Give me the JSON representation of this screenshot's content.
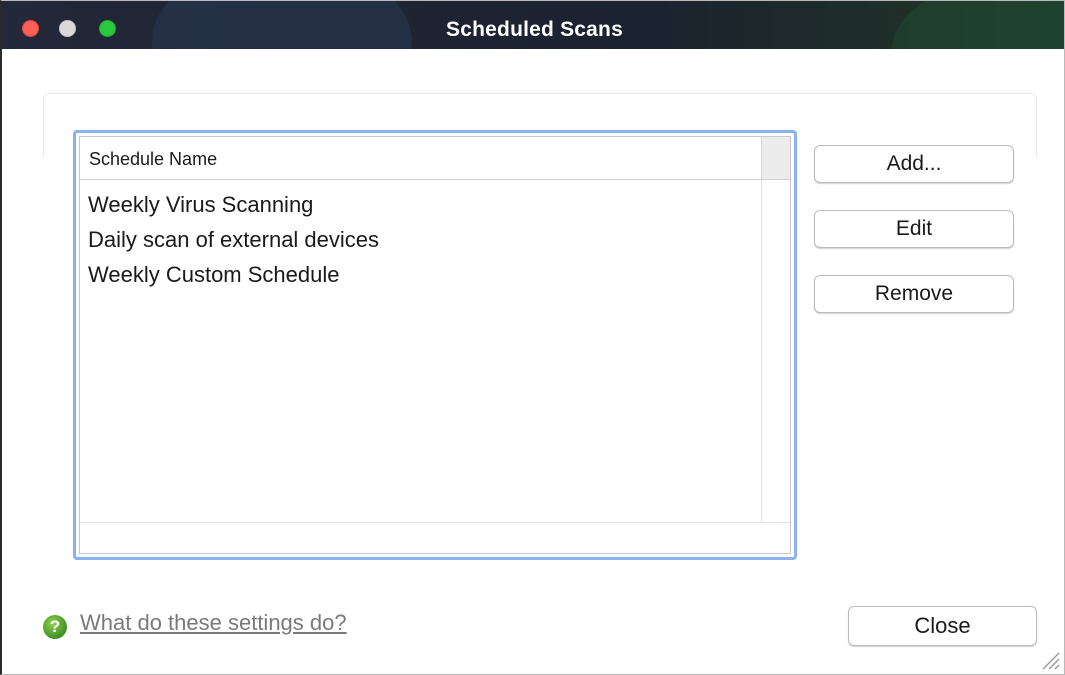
{
  "window": {
    "title": "Scheduled Scans",
    "controls": {
      "close_color": "#fe5f57",
      "minimize_color": "#d9d9d9",
      "zoom_color": "#2ac840"
    }
  },
  "schedule_list": {
    "column_header": "Schedule Name",
    "items": [
      "Weekly Virus Scanning",
      "Daily scan of external devices",
      "Weekly Custom Schedule"
    ],
    "focus_color": "#8ab2f0"
  },
  "buttons": {
    "add_label": "Add...",
    "edit_label": "Edit",
    "remove_label": "Remove",
    "close_label": "Close"
  },
  "help": {
    "icon": "question-icon",
    "icon_glyph": "?",
    "link_text": "What do these settings do?"
  }
}
